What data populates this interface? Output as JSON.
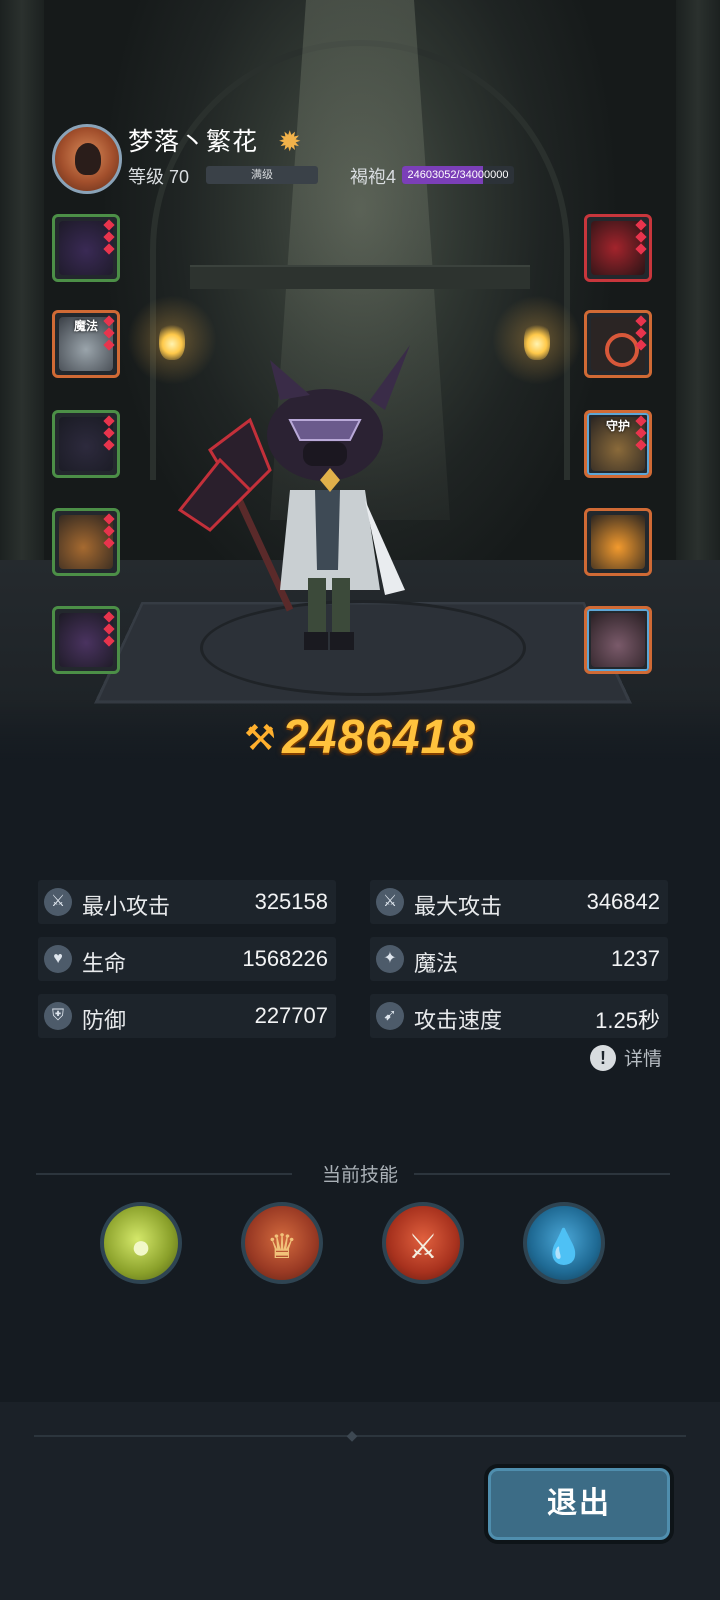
{
  "player": {
    "name": "梦落丶繁花",
    "level_label": "等级 70",
    "level_bar_text": "满级",
    "robe_label": "褐袍4",
    "robe_exp_text": "24603052/34000000",
    "robe_progress": 0.7236
  },
  "equipment": {
    "left": [
      {
        "name": "helmet",
        "color": "green"
      },
      {
        "name": "armor",
        "color": "orange",
        "tag": "魔法"
      },
      {
        "name": "boots",
        "color": "green"
      },
      {
        "name": "bow",
        "color": "green"
      },
      {
        "name": "shoulder",
        "color": "green"
      }
    ],
    "right": [
      {
        "name": "weapon",
        "color": "red"
      },
      {
        "name": "ring",
        "color": "orange"
      },
      {
        "name": "necklace",
        "color": "orange",
        "tag": "守护"
      },
      {
        "name": "talisman",
        "color": "orange"
      },
      {
        "name": "pet",
        "color": "orange"
      }
    ]
  },
  "power": {
    "value": "2486418"
  },
  "stats": [
    {
      "label": "最小攻击",
      "value": "325158",
      "icon": "sword-icon"
    },
    {
      "label": "最大攻击",
      "value": "346842",
      "icon": "sword-icon"
    },
    {
      "label": "生命",
      "value": "1568226",
      "icon": "heart-icon"
    },
    {
      "label": "魔法",
      "value": "1237",
      "icon": "magic-icon"
    },
    {
      "label": "防御",
      "value": "227707",
      "icon": "shield-icon"
    },
    {
      "label": "攻击速度",
      "value": "1.25秒",
      "icon": "speed-icon"
    }
  ],
  "detail_label": "详情",
  "skills": {
    "title": "当前技能",
    "items": [
      {
        "name": "poison-bubbles-icon",
        "color": "#a6c23a"
      },
      {
        "name": "crown-shield-icon",
        "color": "#c2553a"
      },
      {
        "name": "crossed-axes-icon",
        "color": "#c9452e"
      },
      {
        "name": "water-shield-icon",
        "color": "#2f7eaa"
      }
    ]
  },
  "exit_label": "退出"
}
